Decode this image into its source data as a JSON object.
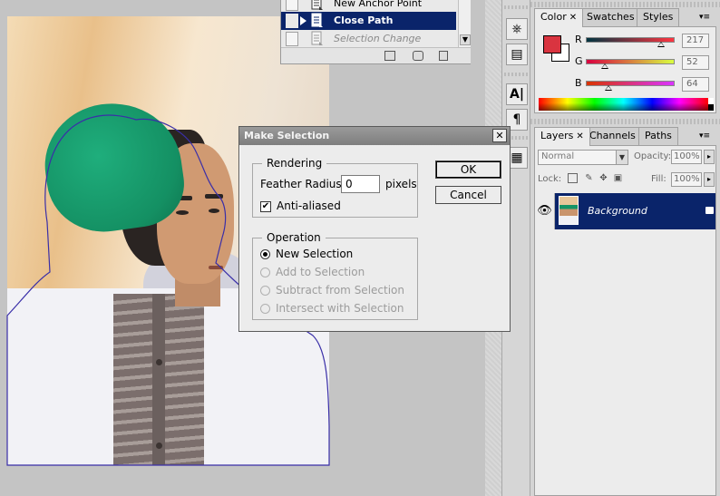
{
  "history": {
    "items": [
      {
        "label": "New Anchor Point",
        "state": "normal"
      },
      {
        "label": "Close Path",
        "state": "selected"
      },
      {
        "label": "Selection Change",
        "state": "disabled"
      }
    ]
  },
  "color_panel": {
    "tabs": [
      {
        "label": "Color",
        "active": true,
        "closable": true
      },
      {
        "label": "Swatches",
        "active": false
      },
      {
        "label": "Styles",
        "active": false
      }
    ],
    "foreground_color": "#d93440",
    "background_color": "#ffffff",
    "channels": [
      {
        "name": "R",
        "value": "217",
        "fraction": 0.851
      },
      {
        "name": "G",
        "value": "52",
        "fraction": 0.204
      },
      {
        "name": "B",
        "value": "64",
        "fraction": 0.251
      }
    ]
  },
  "layers_panel": {
    "tabs": [
      {
        "label": "Layers",
        "active": true,
        "closable": true
      },
      {
        "label": "Channels",
        "active": false
      },
      {
        "label": "Paths",
        "active": false
      }
    ],
    "blend_mode": "Normal",
    "opacity_label": "Opacity:",
    "opacity_value": "100%",
    "lock_label": "Lock:",
    "fill_label": "Fill:",
    "fill_value": "100%",
    "layers": [
      {
        "name": "Background",
        "visible": true,
        "locked": true,
        "selected": true
      }
    ]
  },
  "dialog": {
    "title": "Make Selection",
    "close_glyph": "✕",
    "rendering": {
      "group_label": "Rendering",
      "feather_label": "Feather Radius:",
      "feather_value": "0",
      "feather_unit": "pixels",
      "antialiased_label": "Anti-aliased",
      "antialiased_checked": true
    },
    "operation": {
      "group_label": "Operation",
      "options": [
        {
          "label": "New Selection",
          "selected": true,
          "enabled": true
        },
        {
          "label": "Add to Selection",
          "selected": false,
          "enabled": false
        },
        {
          "label": "Subtract from Selection",
          "selected": false,
          "enabled": false
        },
        {
          "label": "Intersect with Selection",
          "selected": false,
          "enabled": false
        }
      ]
    },
    "ok_label": "OK",
    "cancel_label": "Cancel"
  },
  "colors": {
    "selection_blue": "#0a246a",
    "cap_green": "#149063"
  },
  "icons": {
    "history_item": "history-state-icon",
    "tool_buttons": [
      "usb-icon",
      "clone-source-icon",
      "character-icon",
      "paragraph-icon",
      "tool-presets-icon"
    ]
  }
}
